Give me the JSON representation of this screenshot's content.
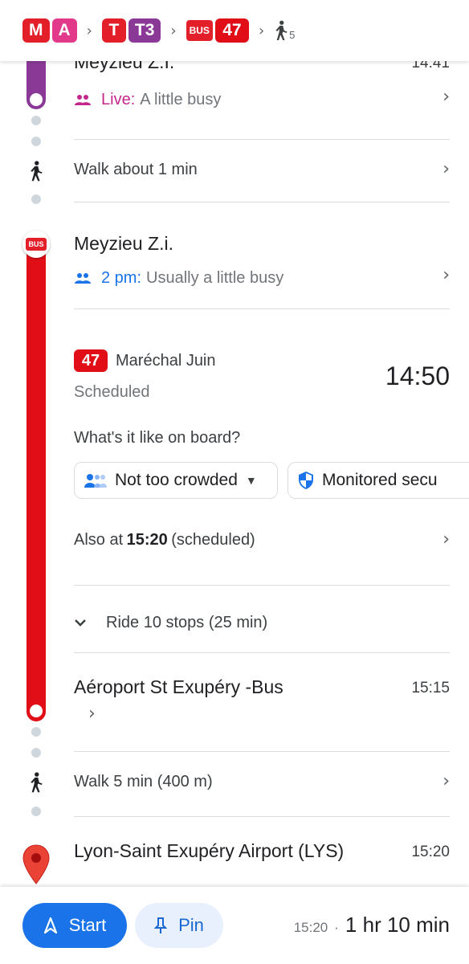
{
  "header": {
    "segments": [
      {
        "mode": "M",
        "line": "A"
      },
      {
        "mode": "T",
        "line": "T3"
      },
      {
        "mode": "BUS",
        "line": "47"
      }
    ],
    "walk_count": "5",
    "colors": {
      "metro": "#e3202a",
      "line_a": "#e2398b",
      "line_t3": "#8a3a96",
      "bus_47": "#e10e17"
    }
  },
  "steps": {
    "arrival_tram": {
      "stop": "Meyzieu Z.I.",
      "time": "14:41",
      "live_label": "Live:",
      "live_status": "A little busy"
    },
    "walk1": {
      "text": "Walk about 1 min"
    },
    "bus_board": {
      "stop": "Meyzieu Z.i.",
      "crowd_time": "2 pm:",
      "crowd_status": "Usually a little busy"
    },
    "bus_details": {
      "line": "47",
      "direction": "Maréchal Juin",
      "status": "Scheduled",
      "departure": "14:50",
      "onboard_question": "What's it like on board?",
      "chip_crowd": "Not too crowded",
      "chip_security": "Monitored secu",
      "also_prefix": "Also at",
      "also_time": "15:20",
      "also_suffix": "(scheduled)",
      "ride_summary": "Ride 10 stops (25 min)"
    },
    "bus_alight": {
      "stop": "Aéroport St Exupéry -Bus",
      "time": "15:15"
    },
    "walk2": {
      "text": "Walk 5 min (400 m)"
    },
    "destination": {
      "name": "Lyon-Saint Exupéry Airport (LYS)",
      "time": "15:20"
    }
  },
  "bottom": {
    "start_label": "Start",
    "pin_label": "Pin",
    "arrival": "15:20",
    "separator": "·",
    "duration": "1 hr 10 min"
  }
}
